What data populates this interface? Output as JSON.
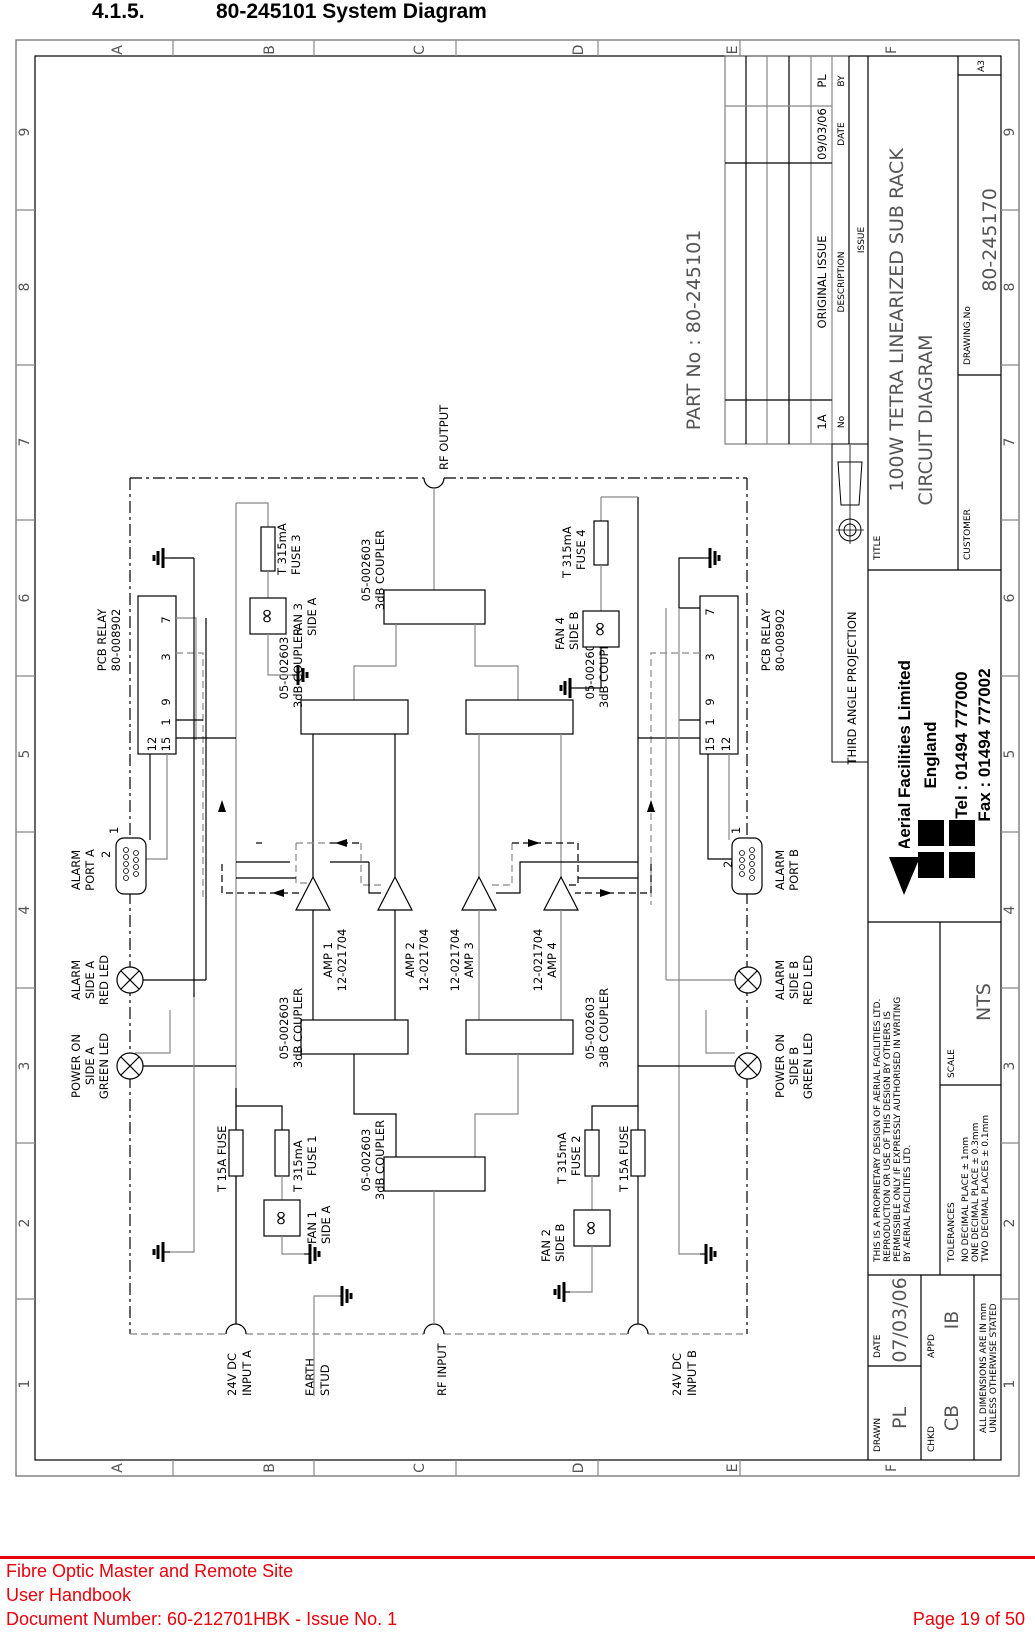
{
  "heading": {
    "number": "4.1.5.",
    "title": "80-245101 System Diagram"
  },
  "border": {
    "rows": [
      "A",
      "B",
      "C",
      "D",
      "E",
      "F"
    ],
    "cols": [
      "1",
      "2",
      "3",
      "4",
      "5",
      "6",
      "7",
      "8",
      "9"
    ]
  },
  "diagram": {
    "part_no": "PART No : 80-245101",
    "rf_output": "RF OUTPUT",
    "rf_input": "RF INPUT",
    "dc_input_a": [
      "24V DC",
      "INPUT A"
    ],
    "dc_input_b": [
      "24V DC",
      "INPUT B"
    ],
    "earth_stud": [
      "EARTH",
      "STUD"
    ],
    "relay_a": [
      "PCB RELAY",
      "80-008902"
    ],
    "relay_b": [
      "PCB RELAY",
      "80-008902"
    ],
    "relay_pins_a": [
      "12",
      "15",
      "1",
      "9",
      "3",
      "7"
    ],
    "relay_pins_b": [
      "15",
      "12",
      "1",
      "9",
      "3",
      "7"
    ],
    "alarm_port_a": [
      "ALARM",
      "PORT A"
    ],
    "alarm_port_b": [
      "ALARM",
      "PORT B"
    ],
    "port_pin_1": "1",
    "port_pin_2": "2",
    "alarm_led_a": [
      "ALARM",
      "SIDE A",
      "RED LED"
    ],
    "alarm_led_b": [
      "ALARM",
      "SIDE B",
      "RED LED"
    ],
    "power_led_a": [
      "POWER ON",
      "SIDE A",
      "GREEN LED"
    ],
    "power_led_b": [
      "POWER ON",
      "SIDE B",
      "GREEN LED"
    ],
    "fuse_15a_a": "T 15A FUSE",
    "fuse_15a_b": "T 15A FUSE",
    "fuse_1": [
      "T 315mA",
      "FUSE 1"
    ],
    "fuse_2": [
      "T 315mA",
      "FUSE 2"
    ],
    "fuse_3": [
      "T 315mA",
      "FUSE 3"
    ],
    "fuse_4": [
      "T 315mA",
      "FUSE 4"
    ],
    "fan_1": [
      "FAN 1",
      "SIDE A"
    ],
    "fan_2": [
      "FAN 2",
      "SIDE B"
    ],
    "fan_3": [
      "FAN 3",
      "SIDE A"
    ],
    "fan_4": [
      "FAN 4",
      "SIDE B"
    ],
    "coupler": [
      "05-002603",
      "3dB COUPLER"
    ],
    "amp_1": [
      "AMP 1",
      "12-021704"
    ],
    "amp_2": [
      "AMP 2",
      "12-021704"
    ],
    "amp_3": [
      "12-021704",
      "AMP 3"
    ],
    "amp_4": [
      "12-021704",
      "AMP 4"
    ]
  },
  "title_block": {
    "revision": {
      "no": "1A",
      "description": "ORIGINAL ISSUE",
      "date": "09/03/06",
      "by": "PL",
      "headers": {
        "no": "No",
        "description": "DESCRIPTION",
        "date": "DATE",
        "by": "BY",
        "issue": "ISSUE"
      }
    },
    "projection": "THIRD ANGLE PROJECTION",
    "title_label": "TITLE",
    "title_line1": "100W TETRA LINEARIZED SUB RACK",
    "title_line2": "CIRCUIT DIAGRAM",
    "customer_label": "CUSTOMER",
    "drawing_no_label": "DRAWING.No",
    "drawing_no": "80-245170",
    "sheet_size": "A3",
    "company": {
      "name": "Aerial Facilities Limited",
      "country": "England",
      "tel": "Tel : 01494 777000",
      "fax": "Fax : 01494 777002"
    },
    "notice": [
      "THIS IS A PROPRIETARY DESIGN OF AERIAL FACILITIES LTD.",
      "REPRODUCTION OR USE OF THIS DESIGN BY OTHERS IS",
      "PERMISSIBLE ONLY IF EXPRESSLY AUTHORISED IN WRITING",
      "BY AERIAL FACILITIES LTD."
    ],
    "scale_label": "SCALE",
    "scale": "NTS",
    "tolerances_label": "TOLERANCES",
    "tolerances": [
      "NO DECIMAL PLACE ± 1mm",
      "ONE DECIMAL PLACE ± 0.3mm",
      "TWO DECIMAL PLACES ± 0.1mm"
    ],
    "drawn_label": "DRAWN",
    "drawn": "PL",
    "date_label": "DATE",
    "date": "07/03/06",
    "chkd_label": "CHKD",
    "chkd": "CB",
    "appd_label": "APPD",
    "appd": "IB",
    "dimensions_note": [
      "ALL DIMENSIONS ARE IN mm",
      "UNLESS OTHERWISE STATED"
    ]
  },
  "footer": {
    "line1": "Fibre Optic Master and Remote Site",
    "line2": "User Handbook",
    "line3": "Document Number: 60-212701HBK - Issue No. 1",
    "page": "Page 19 of 50"
  }
}
